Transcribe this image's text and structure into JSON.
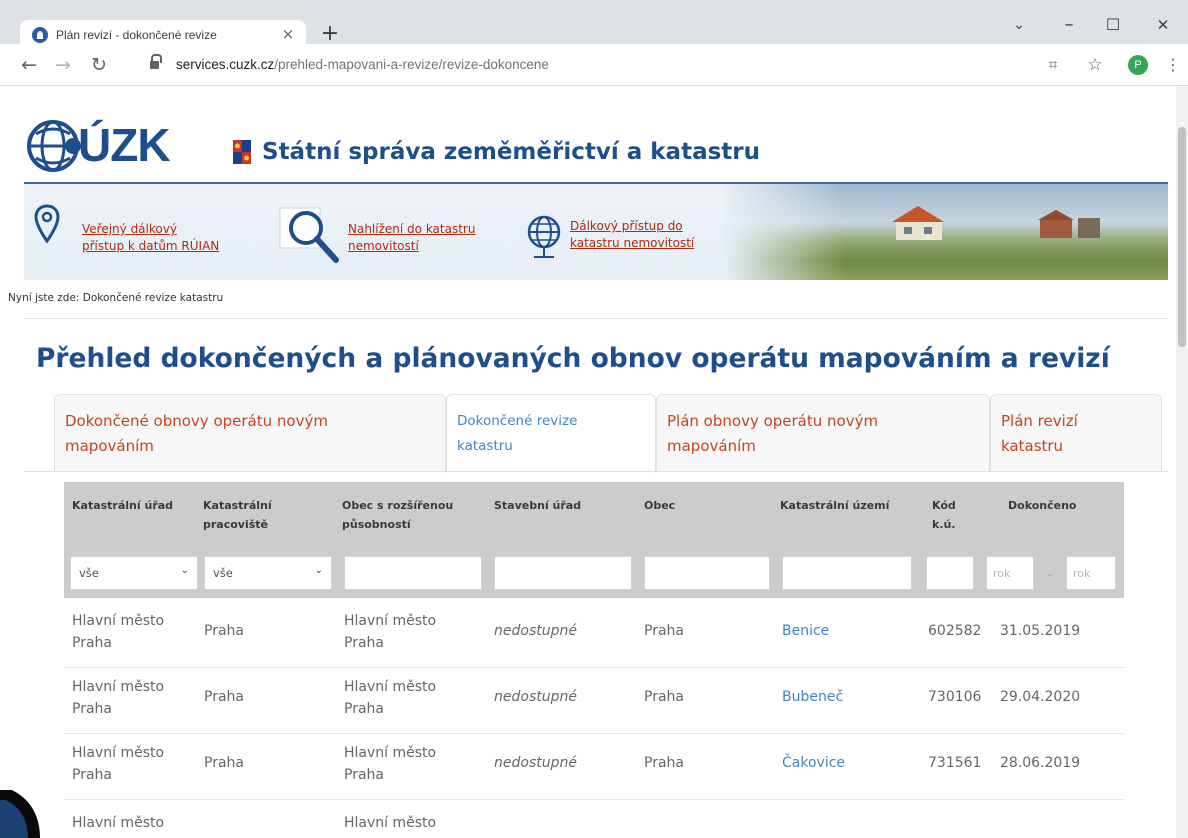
{
  "browser": {
    "tab_title": "Plán revizí - dokončené revize",
    "tab_close": "×",
    "new_tab": "+",
    "window": {
      "dropdown": "⌄",
      "minimize": "–",
      "maximize": "☐",
      "close": "✕"
    },
    "url_host": "services.cuzk.cz",
    "url_path": "/prehled-mapovani-a-revize/revize-dokoncene",
    "profile_initial": "P",
    "nav": {
      "back": "←",
      "forward": "→",
      "reload": "↻"
    },
    "toolbar_icons": {
      "qr": "⌗",
      "star": "☆",
      "menu": "⋮"
    }
  },
  "header": {
    "logo_text": "ÚZK",
    "site_title": "Státní správa zeměměřictví a katastru"
  },
  "quick_links": [
    {
      "line1": "Veřejný dálkový",
      "line2": "přístup k datům RÚIAN",
      "icon": "map-pin-icon"
    },
    {
      "line1": "Nahlížení do katastru",
      "line2": "nemovitostí",
      "icon": "magnifier-icon"
    },
    {
      "line1": "Dálkový přístup do",
      "line2": "katastru nemovitostí",
      "icon": "globe-network-icon"
    }
  ],
  "breadcrumb": "Nyní jste zde: Dokončené revize katastru",
  "page_title": "Přehled dokončených a plánovaných obnov operátu mapováním a revizí",
  "tabs": [
    {
      "line1": "Dokončené obnovy operátu novým",
      "line2": "mapováním",
      "active": false
    },
    {
      "line1": "Dokončené revize",
      "line2": "katastru",
      "active": true
    },
    {
      "line1": "Plán obnovy operátu novým",
      "line2": "mapováním",
      "active": false
    },
    {
      "line1": "Plán revizí",
      "line2": "katastru",
      "active": false
    }
  ],
  "table": {
    "headers": [
      {
        "l1": "Katastrální úřad",
        "l2": ""
      },
      {
        "l1": "Katastrální",
        "l2": "pracoviště"
      },
      {
        "l1": "Obec s rozšířenou",
        "l2": "působností"
      },
      {
        "l1": "Stavební úřad",
        "l2": ""
      },
      {
        "l1": "Obec",
        "l2": ""
      },
      {
        "l1": "Katastrální území",
        "l2": ""
      },
      {
        "l1": "Kód",
        "l2": "k.ú."
      },
      {
        "l1": "Dokončeno",
        "l2": ""
      }
    ],
    "filters": {
      "urad": "vše",
      "pracoviste": "vše",
      "rok_from_placeholder": "rok",
      "rok_dash": "-",
      "rok_to_placeholder": "rok"
    },
    "rows": [
      {
        "urad1": "Hlavní město",
        "urad2": "Praha",
        "pracoviste": "Praha",
        "orp1": "Hlavní město",
        "orp2": "Praha",
        "stavebni": "nedostupné",
        "obec": "Praha",
        "ku": "Benice",
        "kod": "602582",
        "dokonceno": "31.05.2019"
      },
      {
        "urad1": "Hlavní město",
        "urad2": "Praha",
        "pracoviste": "Praha",
        "orp1": "Hlavní město",
        "orp2": "Praha",
        "stavebni": "nedostupné",
        "obec": "Praha",
        "ku": "Bubeneč",
        "kod": "730106",
        "dokonceno": "29.04.2020"
      },
      {
        "urad1": "Hlavní město",
        "urad2": "Praha",
        "pracoviste": "Praha",
        "orp1": "Hlavní město",
        "orp2": "Praha",
        "stavebni": "nedostupné",
        "obec": "Praha",
        "ku": "Čakovice",
        "kod": "731561",
        "dokonceno": "28.06.2019"
      },
      {
        "urad1": "Hlavní město",
        "urad2": "",
        "pracoviste": "",
        "orp1": "Hlavní město",
        "orp2": "",
        "stavebni": "",
        "obec": "",
        "ku": "",
        "kod": "",
        "dokonceno": ""
      }
    ]
  },
  "colors": {
    "brand_blue": "#1f4e8c",
    "link_orange": "#c4461c",
    "link_blue": "#3f86c7"
  }
}
